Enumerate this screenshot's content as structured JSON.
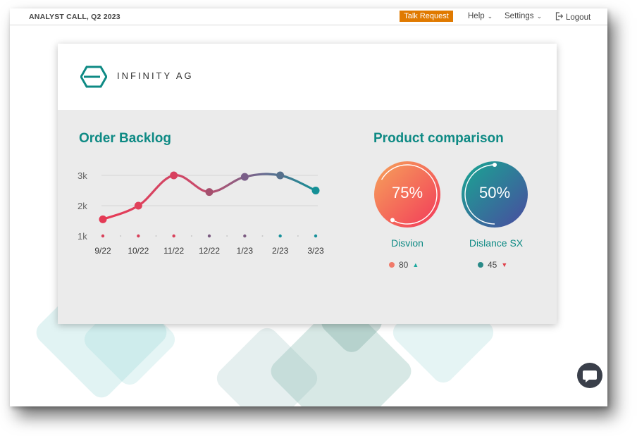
{
  "topbar": {
    "event_title": "ANALYST CALL, Q2 2023",
    "talk_request": "Talk Request",
    "help": "Help",
    "settings": "Settings",
    "logout": "Logout"
  },
  "company": {
    "name": "INFINITY AG"
  },
  "order_backlog": {
    "title": "Order Backlog"
  },
  "product_comparison": {
    "title": "Product comparison",
    "products": [
      {
        "name": "Disvion",
        "percent_label": "75%",
        "count": "80",
        "trend": "up",
        "dot_color": "#f07a6a"
      },
      {
        "name": "Dislance SX",
        "percent_label": "50%",
        "count": "45",
        "trend": "down",
        "dot_color": "#2a8a88"
      }
    ]
  },
  "colors": {
    "accent": "#0e8a84",
    "talk_request_bg": "#e07a00",
    "trend_up": "#1aa89e",
    "trend_down": "#e0404a"
  },
  "chart_data": {
    "type": "line",
    "categories": [
      "9/22",
      "10/22",
      "11/22",
      "12/22",
      "1/23",
      "2/23",
      "3/23"
    ],
    "series": [
      {
        "values": [
          1550,
          2000,
          3000,
          2450,
          2950,
          3000,
          2500
        ]
      }
    ],
    "yticks": [
      "3k",
      "2k",
      "1k"
    ],
    "ylim": [
      1000,
      3000
    ],
    "grid": true
  }
}
